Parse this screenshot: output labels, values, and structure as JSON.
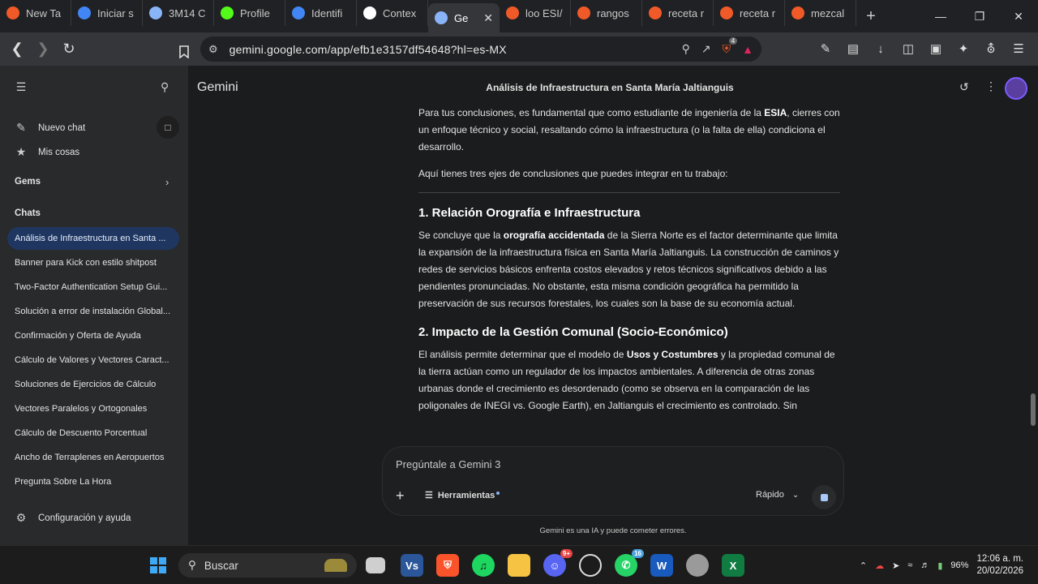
{
  "browser": {
    "tabs": [
      {
        "label": "New Ta",
        "fav": "brave-icon",
        "color": "#f05a28"
      },
      {
        "label": "Iniciar s",
        "fav": "google-icon",
        "color": "#4285f4"
      },
      {
        "label": "3M14 C",
        "fav": "contacts-icon",
        "color": "#8ab4f8"
      },
      {
        "label": "Profile",
        "fav": "kick-icon",
        "color": "#53fc18"
      },
      {
        "label": "Identifi",
        "fav": "id-icon",
        "color": "#4285f4"
      },
      {
        "label": "Contex",
        "fav": "chatgpt-icon",
        "color": "#ffffff"
      },
      {
        "label": "Ge",
        "fav": "gemini-icon",
        "color": "#8ab4f8",
        "active": true
      },
      {
        "label": "loo ESI/",
        "fav": "brave-icon",
        "color": "#f05a28"
      },
      {
        "label": "rangos",
        "fav": "brave-icon",
        "color": "#f05a28"
      },
      {
        "label": "receta r",
        "fav": "brave-icon",
        "color": "#f05a28"
      },
      {
        "label": "receta r",
        "fav": "brave-icon",
        "color": "#f05a28"
      },
      {
        "label": "mezcal",
        "fav": "brave-icon",
        "color": "#f05a28"
      }
    ],
    "url": "gemini.google.com/app/efb1e3157df54648?hl=es-MX",
    "shield_count": "4"
  },
  "sidebar": {
    "new_chat": "Nuevo chat",
    "my_stuff": "Mis cosas",
    "gems": "Gems",
    "chats_heading": "Chats",
    "chats": [
      "Análisis de Infraestructura en Santa ...",
      "Banner para Kick con estilo shitpost",
      "Two-Factor Authentication Setup Gui...",
      "Solución a error de instalación Global...",
      "Confirmación y Oferta de Ayuda",
      "Cálculo de Valores y Vectores Caract...",
      "Soluciones de Ejercicios de Cálculo",
      "Vectores Paralelos y Ortogonales",
      "Cálculo de Descuento Porcentual",
      "Ancho de Terraplenes en Aeropuertos",
      "Pregunta Sobre La Hora"
    ],
    "settings": "Configuración y ayuda"
  },
  "main": {
    "brand": "Gemini",
    "title": "Análisis de Infraestructura en Santa María Jaltianguis",
    "p1_a": "Para tus conclusiones, es fundamental que como estudiante de ingeniería de la ",
    "p1_b": "ESIA",
    "p1_c": ", cierres con un enfoque técnico y social, resaltando cómo la infraestructura (o la falta de ella) condiciona el desarrollo.",
    "p2": "Aquí tienes tres ejes de conclusiones que puedes integrar en tu trabajo:",
    "h1": "1. Relación Orografía e Infraestructura",
    "s1_a": "Se concluye que la ",
    "s1_b": "orografía accidentada",
    "s1_c": " de la Sierra Norte es el factor determinante que limita la expansión de la infraestructura física en Santa María Jaltianguis. La construcción de caminos y redes de servicios básicos enfrenta costos elevados y retos técnicos significativos debido a las pendientes pronunciadas. No obstante, esta misma condición geográfica ha permitido la preservación de sus recursos forestales, los cuales son la base de su economía actual.",
    "h2": "2. Impacto de la Gestión Comunal (Socio-Económico)",
    "s2_a": "El análisis permite determinar que el modelo de ",
    "s2_b": "Usos y Costumbres",
    "s2_c": " y la propiedad comunal de la tierra actúan como un regulador de los impactos ambientales. A diferencia de otras zonas urbanas donde el crecimiento es desordenado (como se observa en la comparación de las poligonales de INEGI vs. Google Earth), en Jaltianguis el crecimiento es controlado. Sin",
    "placeholder": "Pregúntale a Gemini 3",
    "tools": "Herramientas",
    "mode": "Rápido",
    "disclaimer": "Gemini es una IA y puede cometer errores."
  },
  "taskbar": {
    "search": "Buscar",
    "battery": "96%",
    "time": "12:06 a. m.",
    "date": "20/02/2026",
    "whatsapp_badge": "16",
    "discord_badge": "9+"
  }
}
